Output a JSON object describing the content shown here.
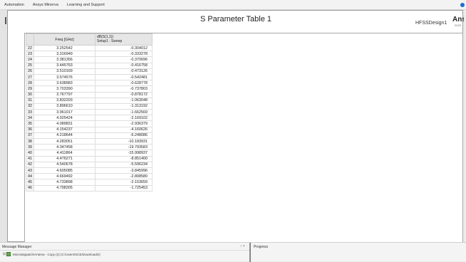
{
  "menu": {
    "items": [
      "Automation",
      "Ansys Minerva",
      "Learning and Support"
    ]
  },
  "report": {
    "title": "S Parameter Table 1",
    "design_name": "HFSSDesign1",
    "brand": "Ansys",
    "brand_sub": "2023"
  },
  "table": {
    "col_freq_header": "Freq [GHz]",
    "col_val_header_line1": "dB(S(1,1))",
    "col_val_header_line2": "Setup1 : Sweep",
    "rows": [
      {
        "idx": "22",
        "freq": "3.252542",
        "val": "-0.304012"
      },
      {
        "idx": "23",
        "freq": "3.316949",
        "val": "-0.333278"
      },
      {
        "idx": "24",
        "freq": "3.381356",
        "val": "-0.370696"
      },
      {
        "idx": "25",
        "freq": "3.445763",
        "val": "-0.416758"
      },
      {
        "idx": "26",
        "freq": "3.510169",
        "val": "-0.473126"
      },
      {
        "idx": "27",
        "freq": "3.574576",
        "val": "-0.542481"
      },
      {
        "idx": "28",
        "freq": "3.638983",
        "val": "-0.628778"
      },
      {
        "idx": "29",
        "freq": "3.703390",
        "val": "-0.737803"
      },
      {
        "idx": "30",
        "freq": "3.767797",
        "val": "-0.878172"
      },
      {
        "idx": "31",
        "freq": "3.832203",
        "val": "-1.063048"
      },
      {
        "idx": "32",
        "freq": "3.896610",
        "val": "-1.313192"
      },
      {
        "idx": "33",
        "freq": "3.961017",
        "val": "-1.662569"
      },
      {
        "idx": "34",
        "freq": "4.025424",
        "val": "-2.169102"
      },
      {
        "idx": "35",
        "freq": "4.089831",
        "val": "-2.936379"
      },
      {
        "idx": "36",
        "freq": "4.154237",
        "val": "-4.160626"
      },
      {
        "idx": "37",
        "freq": "4.218644",
        "val": "-6.248086"
      },
      {
        "idx": "38",
        "freq": "4.283051",
        "val": "-10.183931"
      },
      {
        "idx": "39",
        "freq": "4.347458",
        "val": "-19.793583"
      },
      {
        "idx": "40",
        "freq": "4.411864",
        "val": "-15.998937"
      },
      {
        "idx": "41",
        "freq": "4.476271",
        "val": "-8.851400"
      },
      {
        "idx": "42",
        "freq": "4.540678",
        "val": "-5.596234"
      },
      {
        "idx": "43",
        "freq": "4.605085",
        "val": "-3.845996"
      },
      {
        "idx": "44",
        "freq": "4.669492",
        "val": "-2.808580"
      },
      {
        "idx": "45",
        "freq": "4.733898",
        "val": "-2.153659"
      },
      {
        "idx": "46",
        "freq": "4.798305",
        "val": "-1.725453"
      }
    ]
  },
  "message_manager": {
    "title": "Message Manager",
    "controls": "↕ ×",
    "expander": "⊟",
    "entry": "Microstippatch/Antena - Copy (2) (C:/Users/SCE/Downloads/)"
  },
  "progress": {
    "title": "Progress"
  },
  "colors": {
    "accent": "#1f6fd0",
    "project_icon": "#6aa84f"
  }
}
